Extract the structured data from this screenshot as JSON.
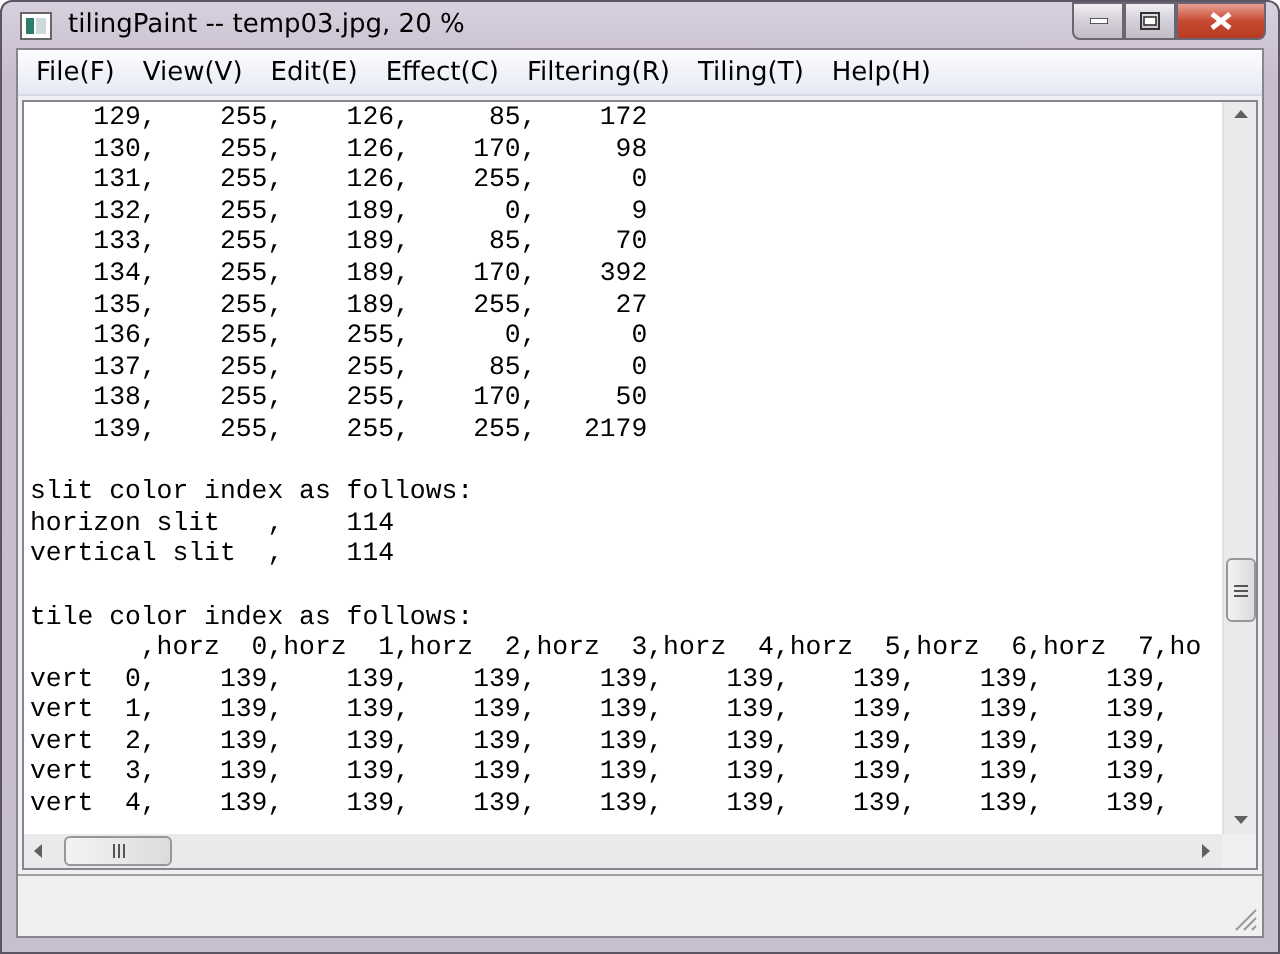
{
  "window": {
    "title": "tilingPaint -- temp03.jpg, 20 %"
  },
  "menu": [
    "File(F)",
    "View(V)",
    "Edit(E)",
    "Effect(C)",
    "Filtering(R)",
    "Tiling(T)",
    "Help(H)"
  ],
  "output": [
    {
      "lines": [
        "    129,    255,    126,     85,    172",
        "    130,    255,    126,    170,     98",
        "    131,    255,    126,    255,      0",
        "    132,    255,    189,      0,      9",
        "    133,    255,    189,     85,     70",
        "    134,    255,    189,    170,    392",
        "    135,    255,    189,    255,     27",
        "    136,    255,    255,      0,      0",
        "    137,    255,    255,     85,      0",
        "    138,    255,    255,    170,     50",
        "    139,    255,    255,    255,   2179"
      ]
    },
    {
      "lines": [
        "slit color index as follows:",
        "horizon slit   ,    114",
        "vertical slit  ,    114"
      ]
    },
    {
      "lines": [
        "tile color index as follows:",
        "       ,horz  0,horz  1,horz  2,horz  3,horz  4,horz  5,horz  6,horz  7,ho",
        "vert  0,    139,    139,    139,    139,    139,    139,    139,    139,",
        "vert  1,    139,    139,    139,    139,    139,    139,    139,    139,",
        "vert  2,    139,    139,    139,    139,    139,    139,    139,    139,",
        "vert  3,    139,    139,    139,    139,    139,    139,    139,    139,",
        "vert  4,    139,    139,    139,    139,    139,    139,    139,    139,"
      ]
    }
  ]
}
